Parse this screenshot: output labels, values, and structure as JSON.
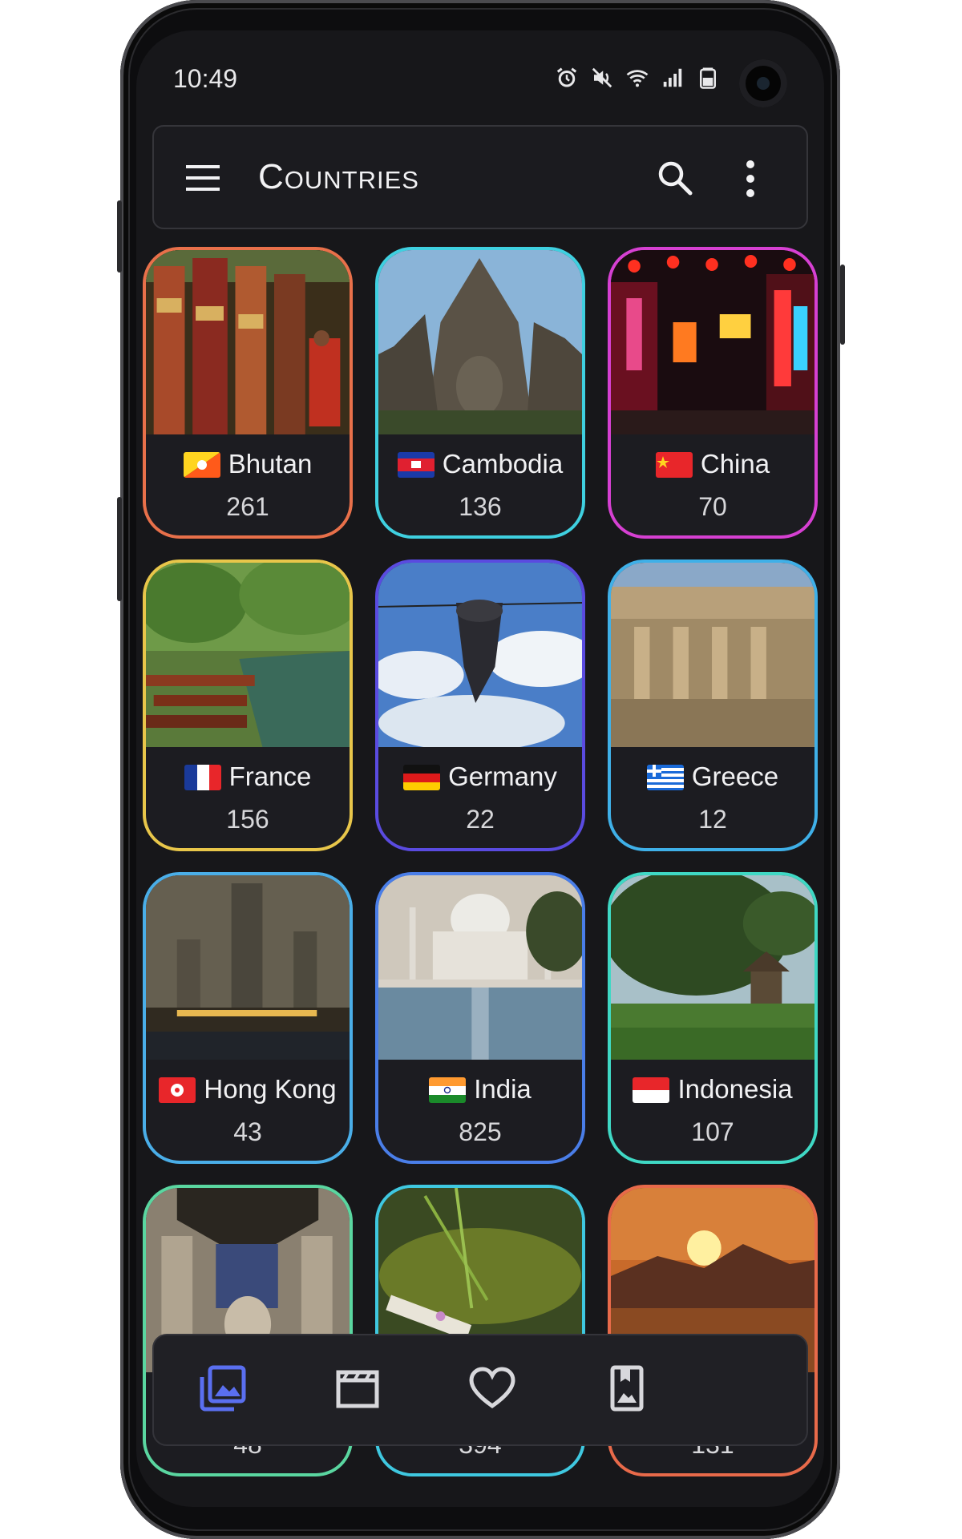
{
  "status_bar": {
    "time": "10:49"
  },
  "app_bar": {
    "title": "Countries"
  },
  "countries": [
    {
      "name": "Bhutan",
      "count": "261",
      "border": "#e8704a"
    },
    {
      "name": "Cambodia",
      "count": "136",
      "border": "#3fd0e0"
    },
    {
      "name": "China",
      "count": "70",
      "border": "#d640d2"
    },
    {
      "name": "France",
      "count": "156",
      "border": "#e8c64a"
    },
    {
      "name": "Germany",
      "count": "22",
      "border": "#5a4be0"
    },
    {
      "name": "Greece",
      "count": "12",
      "border": "#3fb0e8"
    },
    {
      "name": "Hong Kong",
      "count": "43",
      "border": "#4aaee8"
    },
    {
      "name": "India",
      "count": "825",
      "border": "#4a7ee8"
    },
    {
      "name": "Indonesia",
      "count": "107",
      "border": "#3fd8c4"
    },
    {
      "name": "",
      "count": "48",
      "border": "#5ad6a0"
    },
    {
      "name": "",
      "count": "394",
      "border": "#3fc8e0"
    },
    {
      "name": "",
      "count": "131",
      "border": "#e86a4a"
    }
  ],
  "bottom_nav": {
    "items": [
      {
        "icon": "photo-library-icon",
        "active": true
      },
      {
        "icon": "movie-clapper-icon",
        "active": false
      },
      {
        "icon": "heart-icon",
        "active": false
      },
      {
        "icon": "bookmark-photo-icon",
        "active": false
      }
    ],
    "active_color": "#5a6ff0"
  }
}
